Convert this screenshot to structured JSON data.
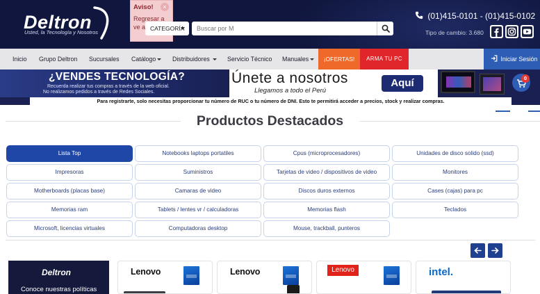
{
  "brand": {
    "name": "Deltron",
    "tagline": "Usted, la Tecnología y Nosotros"
  },
  "notice": {
    "title": "Aviso!",
    "text": "Regresar a ve anterior",
    "close": "×"
  },
  "search": {
    "category_label": "CATEGORÍA",
    "placeholder": "Buscar por M"
  },
  "contact": {
    "phones": "(01)415-0101 - (01)415-0102",
    "exchange_rate": "Tipo de cambio: 3.680"
  },
  "social": [
    "facebook-icon",
    "instagram-icon",
    "youtube-icon"
  ],
  "nav": {
    "items": [
      {
        "label": "Inicio",
        "dropdown": false
      },
      {
        "label": "Grupo Deltron",
        "dropdown": false
      },
      {
        "label": "Sucursales",
        "dropdown": false
      },
      {
        "label": "Catálogo",
        "dropdown": true
      },
      {
        "label": "Distribuidores",
        "dropdown": true
      },
      {
        "label": "Servicio Técnico",
        "dropdown": false
      },
      {
        "label": "Manuales",
        "dropdown": true
      }
    ],
    "ofertas": "¡OFERTAS!",
    "arma": "ARMA TU PC",
    "login": "Iniciar Sesión"
  },
  "banner": {
    "title": "¿VENDES TECNOLOGÍA?",
    "sub1": "Recuerda realizar tus compras a través de la web oficial.",
    "sub2": "No realizamos pedidos a través de Redes Sociales.",
    "une": "Únete a nosotros",
    "llegamos": "Llegamos a todo el Perú",
    "aqui": "Aquí",
    "cart_count": "0",
    "strip": "Para registrarte, solo necesitas proporcionar tu número de RUC o tu número de DNI. Esto te permitirá acceder a precios, stock y realizar compras."
  },
  "section": {
    "title": "Productos Destacados"
  },
  "categories": [
    "Lista Top",
    "Notebooks laptops portatiles",
    "Cpus (microprocesadores)",
    "Unidades de disco solido (ssd)",
    "Impresoras",
    "Suministros",
    "Tarjetas de video / dispositivos de video",
    "Monitores",
    "Motherboards (placas base)",
    "Camaras de video",
    "Discos duros externos",
    "Cases (cajas) para pc",
    "Memorias ram",
    "Tablets / lentes vr / calculadoras",
    "Memorias flash",
    "Teclados",
    "Microsoft, licencias virtuales",
    "Computadoras desktop",
    "Mouse, trackball, punteros"
  ],
  "active_category": "Lista Top",
  "products": {
    "promo_logo": "Deltron",
    "promo_text": "Conoce nuestras políticas",
    "brands": [
      "Lenovo",
      "Lenovo",
      "Lenovo",
      "intel."
    ]
  },
  "colors": {
    "header_bg": "#10163d",
    "accent_blue": "#1f47a8",
    "ofertas_orange": "#ef6a2a",
    "arma_red": "#e1262b",
    "login_blue": "#2d5db5"
  }
}
